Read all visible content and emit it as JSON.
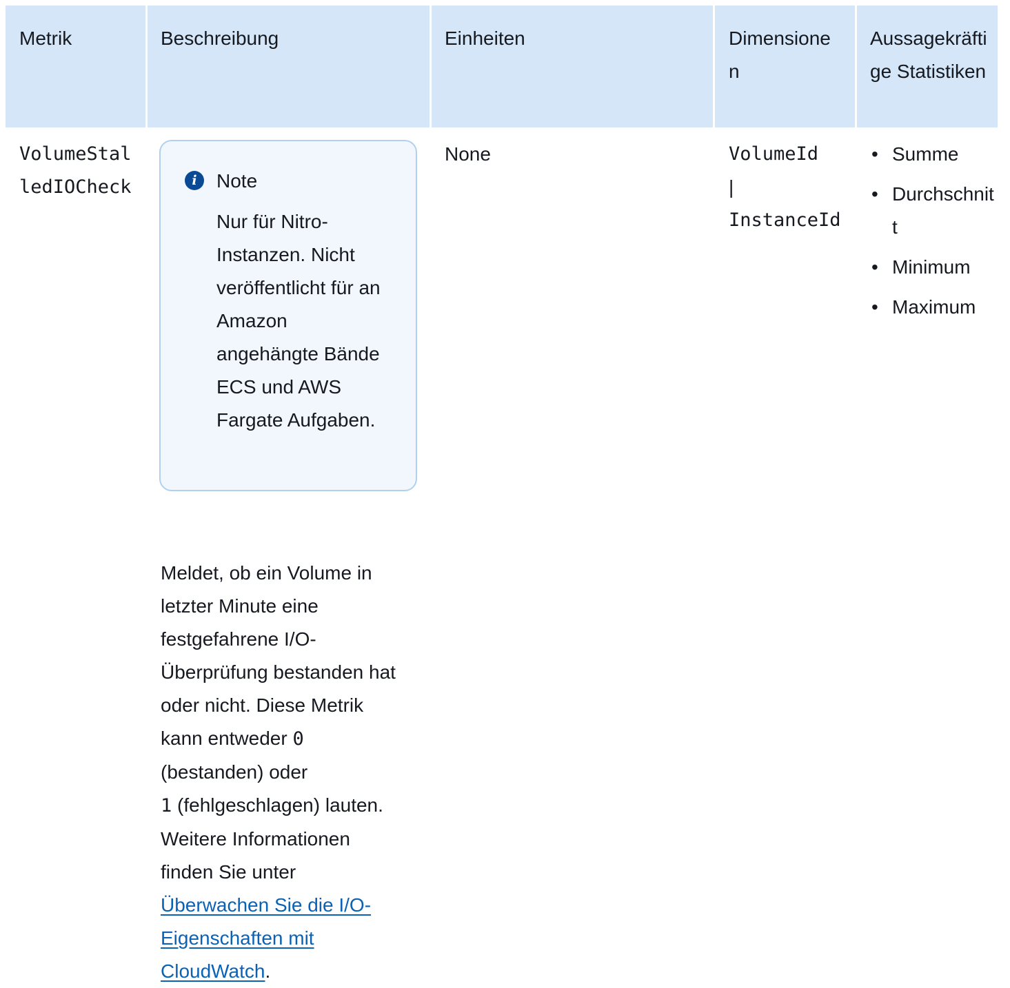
{
  "table": {
    "headers": {
      "metric": "Metrik",
      "description": "Beschreibung",
      "units": "Einheiten",
      "dimensions": "Dimensionen",
      "statistics": "Aussagekräftige Statistiken"
    },
    "row": {
      "metric": "VolumeStalledIOCheck",
      "note_title": "Note",
      "note_body": "Nur für Nitro-Instanzen. Nicht veröffentlicht für an Amazon angehängte Bände ECS und AWS Fargate Aufgaben.",
      "desc_part1": "Meldet, ob ein Volume in letzter Minute eine festgefahrene I/O-Überprüfung bestanden hat oder nicht. Diese Metrik kann entweder ",
      "desc_code0": "0",
      "desc_part2": " (bestanden) oder ",
      "desc_code1": "1",
      "desc_part3": " (fehlgeschlagen) lauten. Weitere Informationen finden Sie unter ",
      "desc_link": "Überwachen Sie die I/O-Eigenschaften mit CloudWatch",
      "desc_end": ".",
      "units": "None",
      "dimension_1": "VolumeId",
      "dimension_sep": "|",
      "dimension_2": "InstanceId",
      "statistics": [
        "Summe",
        "Durchschnitt",
        "Minimum",
        "Maximum"
      ]
    }
  },
  "colors": {
    "header_bg": "#d4e6f7",
    "note_border": "#b1d0ee",
    "note_bg": "#f1f7fd",
    "info_icon": "#0a4a94",
    "link": "#0b62b5"
  },
  "icons": {
    "note": "info-icon"
  }
}
